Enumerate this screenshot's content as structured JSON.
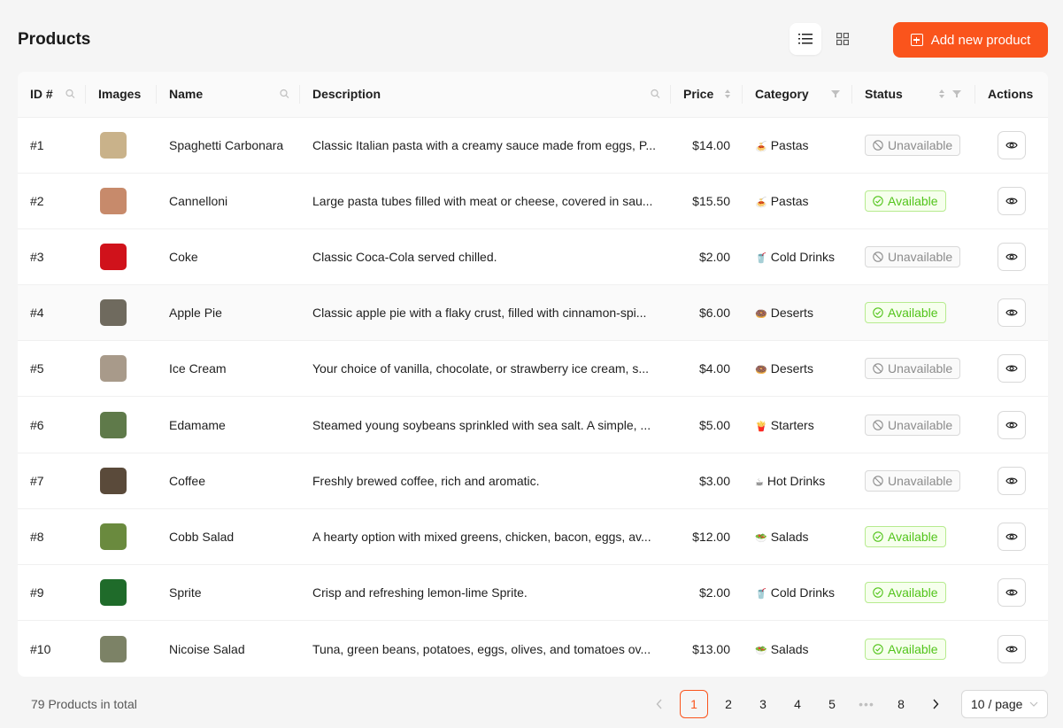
{
  "header": {
    "title": "Products",
    "list_view_icon": "list-icon",
    "grid_view_icon": "grid-icon",
    "add_button_label": "Add new product",
    "accent_color": "#fa541c"
  },
  "table": {
    "columns": {
      "id": "ID #",
      "images": "Images",
      "name": "Name",
      "description": "Description",
      "price": "Price",
      "category": "Category",
      "status": "Status",
      "actions": "Actions"
    },
    "rows": [
      {
        "id": "#1",
        "name": "Spaghetti Carbonara",
        "description": "Classic Italian pasta with a creamy sauce made from eggs, P...",
        "price": "$14.00",
        "category": "Pastas",
        "category_icon": "pasta-icon",
        "status": "Unavailable",
        "image_color": "#c9b28a"
      },
      {
        "id": "#2",
        "name": "Cannelloni",
        "description": "Large pasta tubes filled with meat or cheese, covered in sau...",
        "price": "$15.50",
        "category": "Pastas",
        "category_icon": "pasta-icon",
        "status": "Available",
        "image_color": "#c78a6b"
      },
      {
        "id": "#3",
        "name": "Coke",
        "description": "Classic Coca-Cola served chilled.",
        "price": "$2.00",
        "category": "Cold Drinks",
        "category_icon": "cold-drink-icon",
        "status": "Unavailable",
        "image_color": "#d0121b"
      },
      {
        "id": "#4",
        "name": "Apple Pie",
        "description": "Classic apple pie with a flaky crust, filled with cinnamon-spi...",
        "price": "$6.00",
        "category": "Deserts",
        "category_icon": "donut-icon",
        "status": "Available",
        "image_color": "#6f6a5e"
      },
      {
        "id": "#5",
        "name": "Ice Cream",
        "description": "Your choice of vanilla, chocolate, or strawberry ice cream, s...",
        "price": "$4.00",
        "category": "Deserts",
        "category_icon": "donut-icon",
        "status": "Unavailable",
        "image_color": "#a89a8a"
      },
      {
        "id": "#6",
        "name": "Edamame",
        "description": "Steamed young soybeans sprinkled with sea salt. A simple, ...",
        "price": "$5.00",
        "category": "Starters",
        "category_icon": "fries-icon",
        "status": "Unavailable",
        "image_color": "#5f7a4a"
      },
      {
        "id": "#7",
        "name": "Coffee",
        "description": "Freshly brewed coffee, rich and aromatic.",
        "price": "$3.00",
        "category": "Hot Drinks",
        "category_icon": "hot-drink-icon",
        "status": "Unavailable",
        "image_color": "#5a4a3a"
      },
      {
        "id": "#8",
        "name": "Cobb Salad",
        "description": "A hearty option with mixed greens, chicken, bacon, eggs, av...",
        "price": "$12.00",
        "category": "Salads",
        "category_icon": "salad-icon",
        "status": "Available",
        "image_color": "#6a8a3e"
      },
      {
        "id": "#9",
        "name": "Sprite",
        "description": "Crisp and refreshing lemon-lime Sprite.",
        "price": "$2.00",
        "category": "Cold Drinks",
        "category_icon": "cold-drink-icon",
        "status": "Available",
        "image_color": "#1f6b2a"
      },
      {
        "id": "#10",
        "name": "Nicoise Salad",
        "description": "Tuna, green beans, potatoes, eggs, olives, and tomatoes ov...",
        "price": "$13.00",
        "category": "Salads",
        "category_icon": "salad-icon",
        "status": "Available",
        "image_color": "#7c8266"
      }
    ]
  },
  "footer": {
    "total_text": "79 Products in total",
    "pages": [
      "1",
      "2",
      "3",
      "4",
      "5"
    ],
    "ellipsis": "•••",
    "last_page": "8",
    "current_page": "1",
    "page_size": "10 / page"
  }
}
